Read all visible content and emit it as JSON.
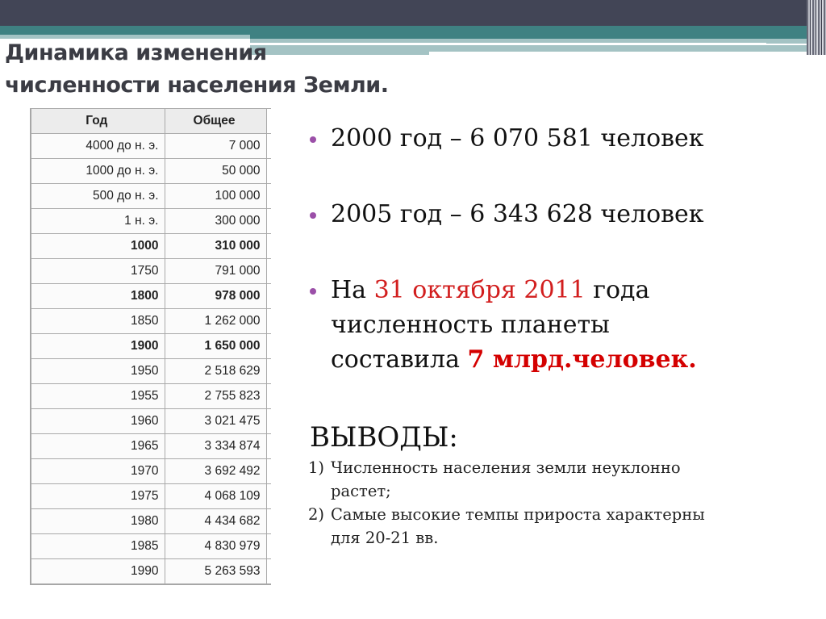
{
  "slide": {
    "title_line1": "Динамика изменения",
    "title_line2": "численности населения Земли.",
    "colors": {
      "header_dark": "#424556",
      "header_teal": "#3f8182",
      "header_light": "#a4c3c4",
      "title": "#3b3c44",
      "bullet": "#9b4fa8",
      "accent_red": "#d21e1e"
    }
  },
  "table": {
    "headers": [
      "Год",
      "Общее"
    ],
    "rows": [
      {
        "year": "4000 до н. э.",
        "total": "7 000",
        "bold": false
      },
      {
        "year": "1000 до н. э.",
        "total": "50 000",
        "bold": false
      },
      {
        "year": "500 до н. э.",
        "total": "100 000",
        "bold": false
      },
      {
        "year": "1 н. э.",
        "total": "300 000",
        "bold": false
      },
      {
        "year": "1000",
        "total": "310 000",
        "bold": true
      },
      {
        "year": "1750",
        "total": "791 000",
        "bold": false
      },
      {
        "year": "1800",
        "total": "978 000",
        "bold": true
      },
      {
        "year": "1850",
        "total": "1 262 000",
        "bold": false
      },
      {
        "year": "1900",
        "total": "1 650 000",
        "bold": true
      },
      {
        "year": "1950",
        "total": "2 518 629",
        "bold": false
      },
      {
        "year": "1955",
        "total": "2 755 823",
        "bold": false
      },
      {
        "year": "1960",
        "total": "3 021 475",
        "bold": false
      },
      {
        "year": "1965",
        "total": "3 334 874",
        "bold": false
      },
      {
        "year": "1970",
        "total": "3 692 492",
        "bold": false
      },
      {
        "year": "1975",
        "total": "4 068 109",
        "bold": false
      },
      {
        "year": "1980",
        "total": "4 434 682",
        "bold": false
      },
      {
        "year": "1985",
        "total": "4 830 979",
        "bold": false
      },
      {
        "year": "1990",
        "total": "5 263 593",
        "bold": false
      }
    ]
  },
  "bullets": {
    "b1": "2000 год – 6 070 581 человек",
    "b2": "2005 год – 6 343 628 человек",
    "b3": {
      "prefix": "На ",
      "date": "31 октября 2011",
      "mid": " года",
      "line2": "численность планеты",
      "line3_prefix": "составила ",
      "highlight": "7 млрд.человек."
    }
  },
  "conclusions": {
    "title": "ВЫВОДЫ:",
    "items": [
      {
        "num": "1)",
        "line1": "Численность населения земли неуклонно",
        "line2": "растет;"
      },
      {
        "num": "2)",
        "line1": "Самые высокие темпы прироста характерны",
        "line2": "для 20-21 вв."
      }
    ]
  }
}
